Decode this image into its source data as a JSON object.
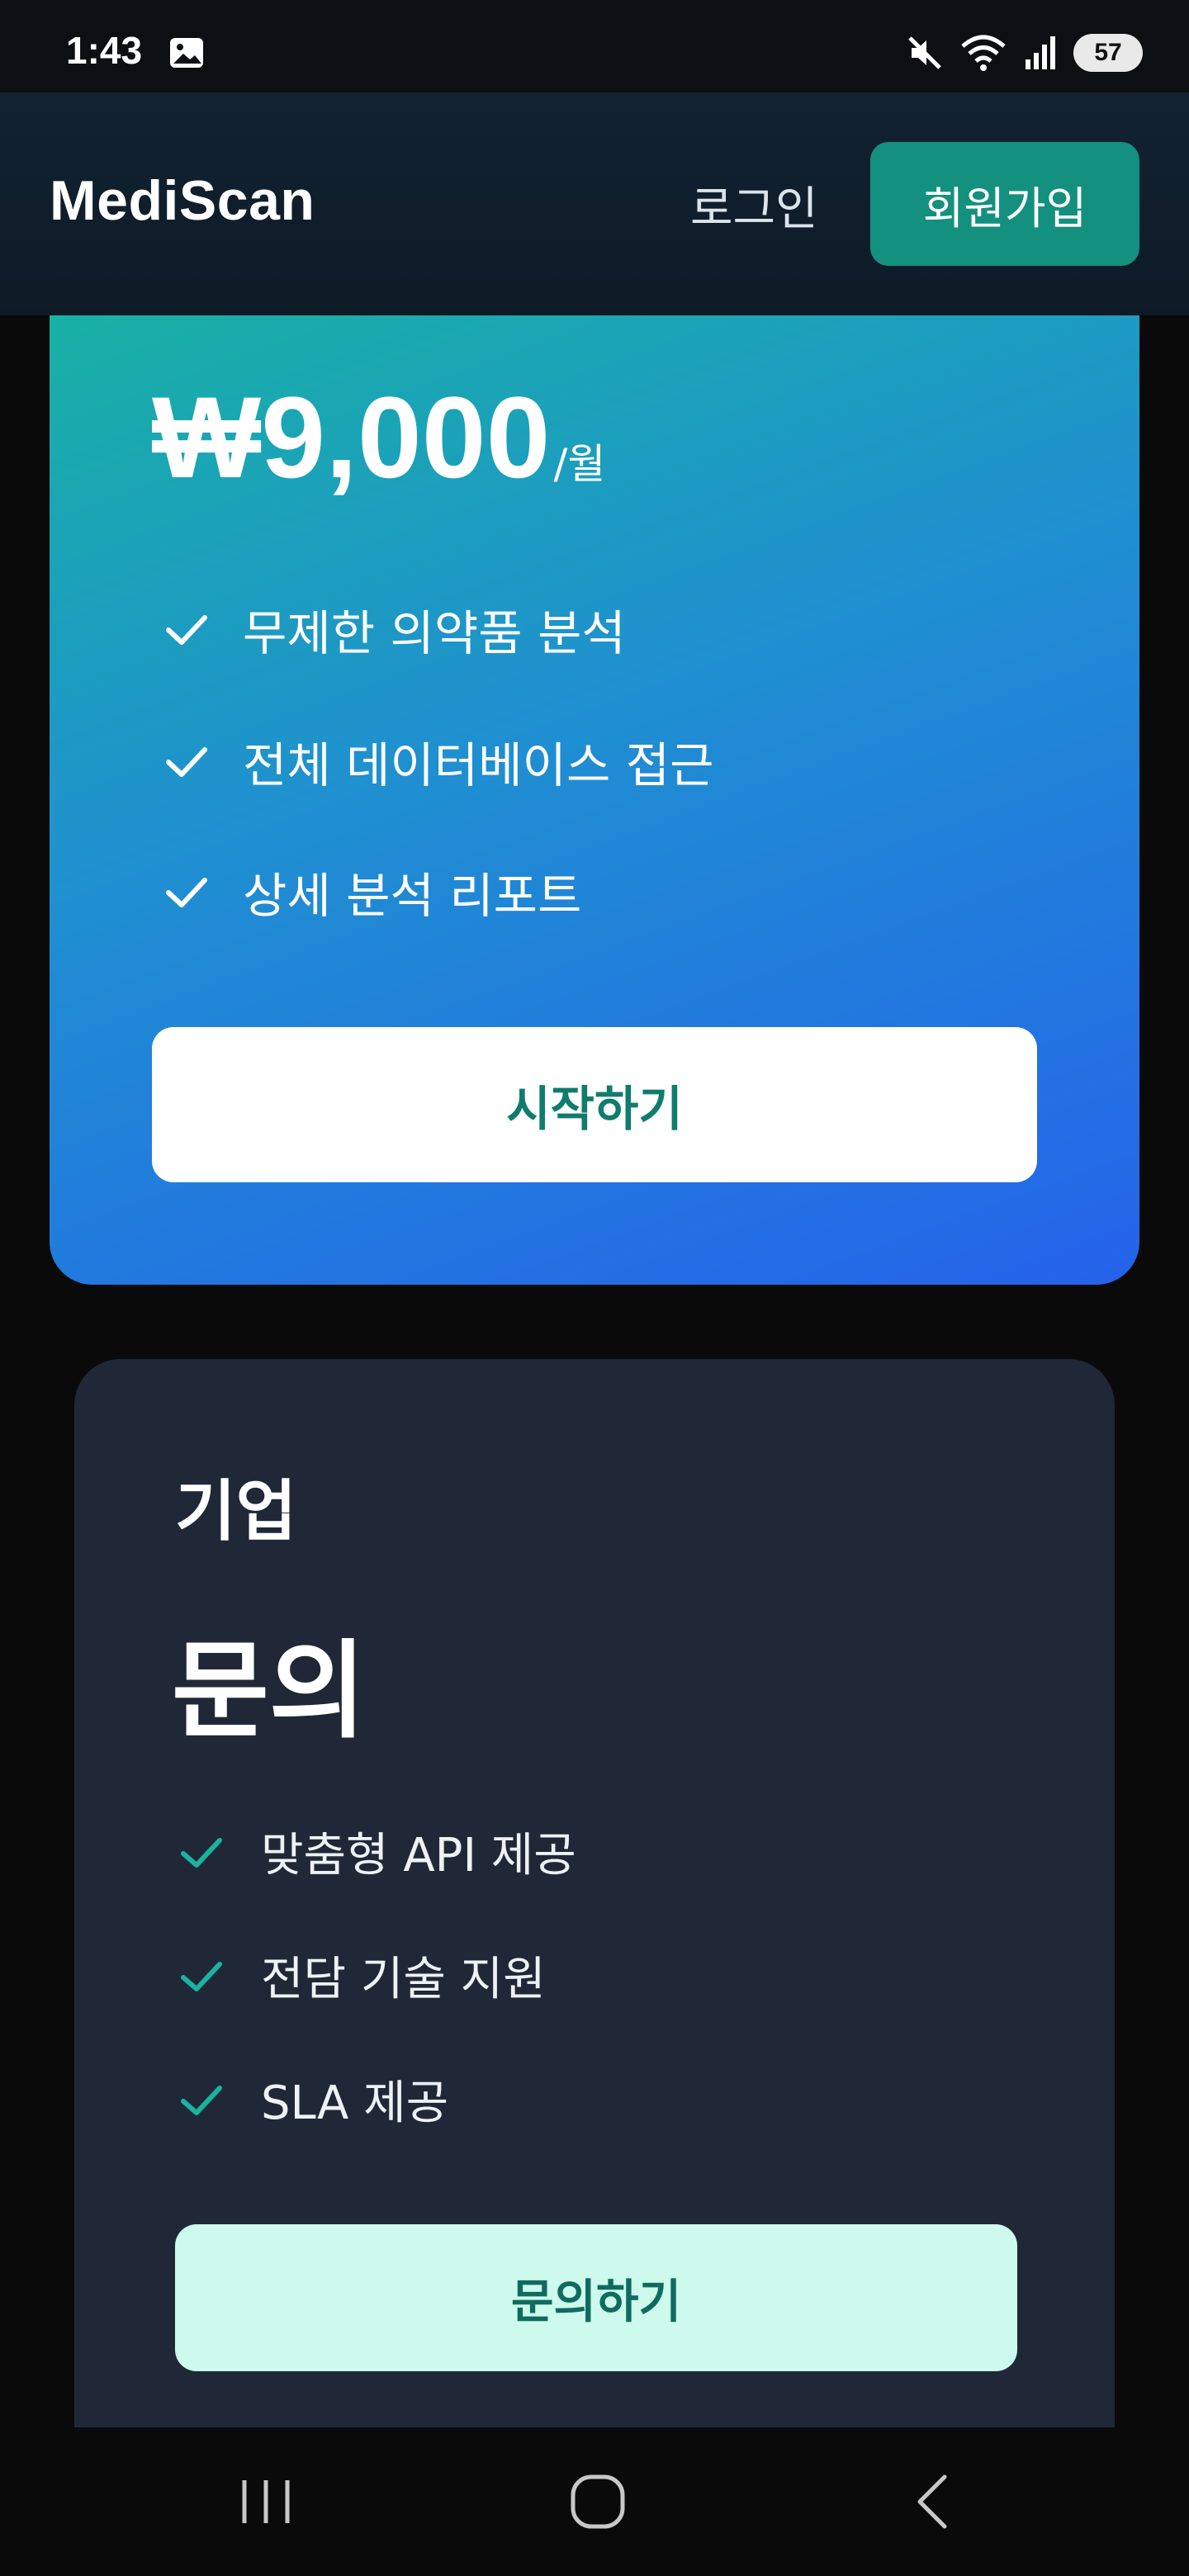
{
  "status_bar": {
    "time": "1:43",
    "battery": "57",
    "icons": [
      "image-icon",
      "mute-icon",
      "wifi-icon",
      "signal-icon"
    ]
  },
  "header": {
    "brand": "MediScan",
    "login_label": "로그인",
    "signup_label": "회원가입"
  },
  "pro_plan": {
    "price": "₩9,000",
    "period": "/월",
    "features": [
      "무제한 의약품 분석",
      "전체 데이터베이스 접근",
      "상세 분석 리포트"
    ],
    "cta_label": "시작하기"
  },
  "enterprise_plan": {
    "title": "기업",
    "price": "문의",
    "features": [
      "맞춤형 API 제공",
      "전담 기술 지원",
      "SLA 제공"
    ],
    "cta_label": "문의하기"
  },
  "colors": {
    "accent": "#14907f",
    "pro_gradient_start": "#18b3a2",
    "pro_gradient_end": "#2563eb",
    "enterprise_bg": "#202837",
    "enterprise_cta_bg": "#cdfaec"
  },
  "nav": {
    "icons": [
      "recents-icon",
      "home-icon",
      "back-icon"
    ]
  }
}
